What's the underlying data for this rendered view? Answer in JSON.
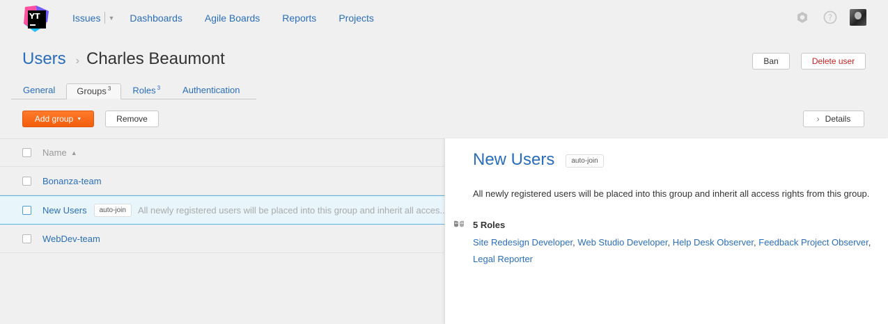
{
  "header": {
    "logo_text": "YT",
    "nav": [
      "Issues",
      "Dashboards",
      "Agile Boards",
      "Reports",
      "Projects"
    ],
    "icons": [
      "settings-icon",
      "help-icon",
      "avatar"
    ]
  },
  "page": {
    "breadcrumb": "Users",
    "user_name": "Charles Beaumont",
    "ban_label": "Ban",
    "delete_label": "Delete user"
  },
  "tabs": [
    {
      "label": "General",
      "count": ""
    },
    {
      "label": "Groups",
      "count": "3"
    },
    {
      "label": "Roles",
      "count": "3"
    },
    {
      "label": "Authentication",
      "count": ""
    }
  ],
  "toolbar": {
    "add_label": "Add group",
    "remove_label": "Remove",
    "details_label": "Details"
  },
  "table": {
    "header": "Name",
    "rows": [
      {
        "name": "Bonanza-team",
        "badge": "",
        "desc": ""
      },
      {
        "name": "New Users",
        "badge": "auto-join",
        "desc": "All newly registered users will be placed into this group and inherit all acces..."
      },
      {
        "name": "WebDev-team",
        "badge": "",
        "desc": ""
      }
    ]
  },
  "panel": {
    "title": "New Users",
    "badge": "auto-join",
    "description": "All newly registered users will be placed into this group and inherit all access rights from this group.",
    "roles_heading": "5 Roles",
    "roles": [
      "Site Redesign Developer",
      "Web Studio Developer",
      "Help Desk Observer",
      "Feedback Project Observer",
      "Legal Reporter"
    ]
  },
  "colors": {
    "link": "#2a6ebb",
    "accent_orange": "#f26b1d",
    "danger": "#cc2222",
    "selection": "#e8f5fb"
  }
}
